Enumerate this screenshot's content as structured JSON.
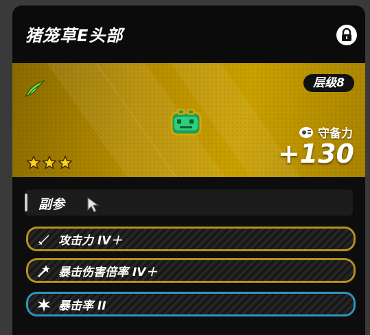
{
  "header": {
    "title": "猪笼草E头部"
  },
  "banner": {
    "level": "层级8",
    "stat_name": "守备力",
    "stat_value": "+130",
    "rarity_stars": 3
  },
  "substats": {
    "title": "副参",
    "rows": [
      {
        "label": "攻击力 IV＋",
        "icon": "sword-icon",
        "style": "gold"
      },
      {
        "label": "暴击伤害倍率 IV＋",
        "icon": "crit-damage-icon",
        "style": "gold"
      },
      {
        "label": "暴击率 II",
        "icon": "crit-rate-icon",
        "style": "blue"
      }
    ]
  },
  "colors": {
    "banner_gold": "#caa000",
    "row_gold_border": "#b8901c",
    "row_blue_border": "#2f95c2",
    "panel_bg": "#0d0d0d"
  }
}
